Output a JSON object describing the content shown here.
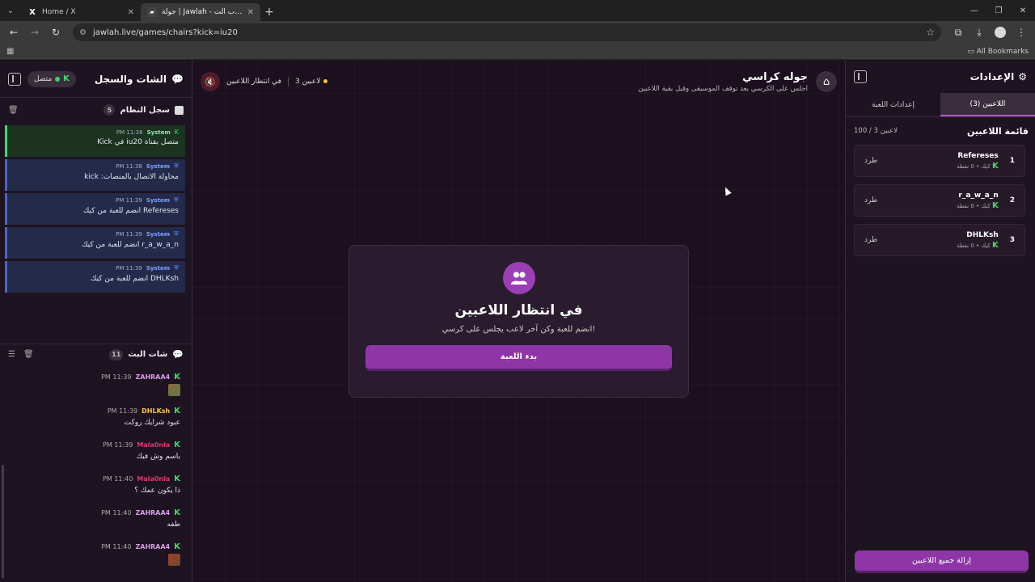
{
  "browser": {
    "tabs": [
      {
        "title": "Home / X",
        "icon": "x-logo-icon",
        "active": false
      },
      {
        "title": "جولة | Jawlah - منصة الألعاب الت...",
        "icon": "jawlah-logo-icon",
        "active": true
      }
    ],
    "url": "jawlah.live/games/chairs?kick=iu20",
    "bookmarks_label": "All Bookmarks"
  },
  "chat_panel": {
    "title": "الشات والسجل",
    "status": "متصل",
    "system_log": {
      "title": "سجل النظام",
      "count": "5",
      "entries": [
        {
          "user": "System",
          "time": "11:38 PM",
          "text": "متصل بقناة iu20 في Kick"
        },
        {
          "user": "System",
          "time": "11:38 PM",
          "text": "محاولة الاتصال بالمنصات: kick"
        },
        {
          "user": "System",
          "time": "11:39 PM",
          "text": "Refereses انضم للعبة من كيك"
        },
        {
          "user": "System",
          "time": "11:39 PM",
          "text": "r_a_w_a_n انضم للعبة من كيك"
        },
        {
          "user": "System",
          "time": "11:39 PM",
          "text": "DHLKsh انضم للعبة من كيك"
        }
      ]
    },
    "live_chat": {
      "title": "شات البث",
      "count": "11",
      "messages": [
        {
          "user": "ZAHRAA4",
          "time": "11:39 PM",
          "text": "",
          "user_color": "#d59be6"
        },
        {
          "user": "DHLKsh",
          "time": "11:39 PM",
          "text": "عبود شرايك روكت",
          "user_color": "#f5c542"
        },
        {
          "user": "Mala0nla",
          "time": "11:39 PM",
          "text": "باسم وش فيك",
          "user_color": "#e0336a"
        },
        {
          "user": "Mala0nla",
          "time": "11:40 PM",
          "text": "ذا يكون عمك ؟",
          "user_color": "#e0336a"
        },
        {
          "user": "ZAHRAA4",
          "time": "11:40 PM",
          "text": "طفه",
          "user_color": "#d59be6"
        },
        {
          "user": "ZAHRAA4",
          "time": "11:40 PM",
          "text": "",
          "user_color": "#d59be6"
        }
      ]
    }
  },
  "game": {
    "title": "جوله كراسي",
    "subtitle": "اجلس على الكرسي بعد توقف الموسيقى وقبل بقية اللاعبين",
    "status": "في انتظار اللاعبين",
    "players_count": "3 لاعبين",
    "waiting_card": {
      "title": "في انتظار اللاعبين",
      "subtitle": "انضم للعبة وكن آخر لاعب يجلس على كرسي!",
      "start_button": "بدء اللعبة"
    }
  },
  "settings": {
    "title": "الإعدادات",
    "tabs": {
      "players": "اللاعبين (3)",
      "game_settings": "إعدادات اللعبة"
    },
    "player_list_title": "قائمة اللاعبين",
    "player_list_count": "100 / 3 لاعبين",
    "kick_label": "طرد",
    "players": [
      {
        "num": "1",
        "name": "Refereses",
        "sub": "كيك • 0 نقطة"
      },
      {
        "num": "2",
        "name": "r_a_w_a_n",
        "sub": "كيك • 0 نقطة"
      },
      {
        "num": "3",
        "name": "DHLKsh",
        "sub": "كيك • 0 نقطة"
      }
    ],
    "remove_all": "إزالة جميع اللاعبين"
  }
}
